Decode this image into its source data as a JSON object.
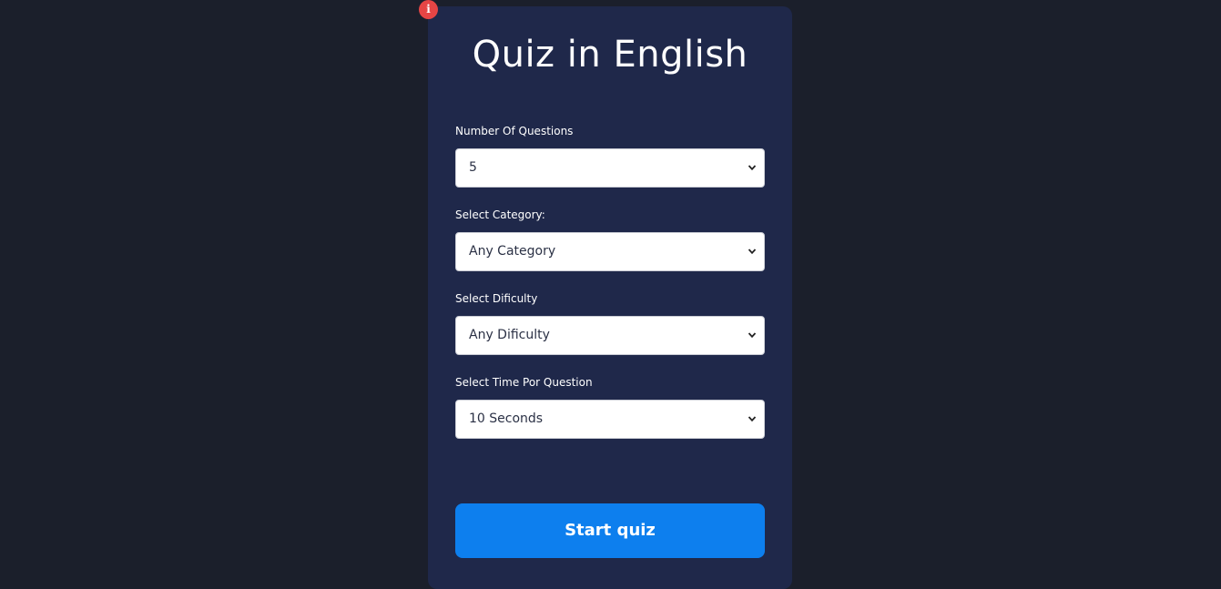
{
  "badge": {
    "icon": "info-icon",
    "glyph": "i",
    "color": "#e64545"
  },
  "quiz": {
    "title": "Quiz in English",
    "fields": [
      {
        "label": "Number Of Questions",
        "value": "5"
      },
      {
        "label": "Select Category:",
        "value": "Any Category"
      },
      {
        "label": "Select Dificulty",
        "value": "Any Dificulty"
      },
      {
        "label": "Select Time Por Question",
        "value": "10 Seconds"
      }
    ],
    "start_label": "Start quiz"
  },
  "colors": {
    "page_background": "#1b1f2b",
    "card_background": "#1f284a",
    "button": "#0d7fee",
    "badge": "#e64545"
  }
}
